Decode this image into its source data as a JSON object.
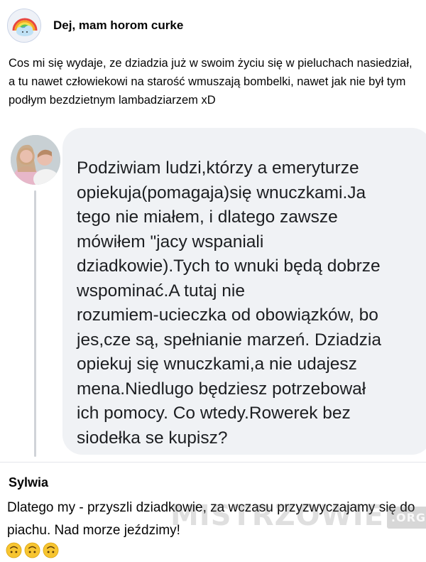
{
  "post": {
    "group_name": "Dej, mam horom curke",
    "text": "Cos mi się wydaje, ze dziadzia już w swoim życiu się w pieluchach nasiedział, a tu nawet człowiekowi na starość wmuszają bombelki, nawet jak nie był tym podłym bezdzietnym lambadziarzem xD",
    "avatar_icon": "rainbow-cloud-icon"
  },
  "screenshot_comment": {
    "avatar_icon": "blurred-profile-photo",
    "text": "Podziwiam ludzi,którzy  a emeryturze\nopiekuja(pomagaja)się wnuczkami.Ja\ntego nie miałem, i dlatego zawsze\nmówiłem \"jacy wspaniali\ndziadkowie).Tych to wnuki będą dobrze\nwspominać.A tutaj nie\nrozumiem-ucieczka od obowiązków, bo\njes,cze są, spełnianie marzeń. Dziadzia\nopiekuj się wnuczkami,a nie udajesz\nmena.Niedlugo będziesz potrzebował\nich pomocy. Co wtedy.Rowerek bez\nsiodełka se kupisz?"
  },
  "reply": {
    "author": "Sylwia",
    "text": "Dlatego my - przyszli dziadkowie, za wczasu przyzwyczajamy się do piachu. Nad morze jeździmy!",
    "emoji_icon": "upside-down-face-emoji",
    "emoji_count": 3
  },
  "watermark": {
    "text": "MISTRZOWIE",
    "tag": ".ORG"
  },
  "colors": {
    "bubble_background": "#f0f2f5",
    "thread_line": "#d0d3d8",
    "emoji_yellow": "#f7c531"
  }
}
